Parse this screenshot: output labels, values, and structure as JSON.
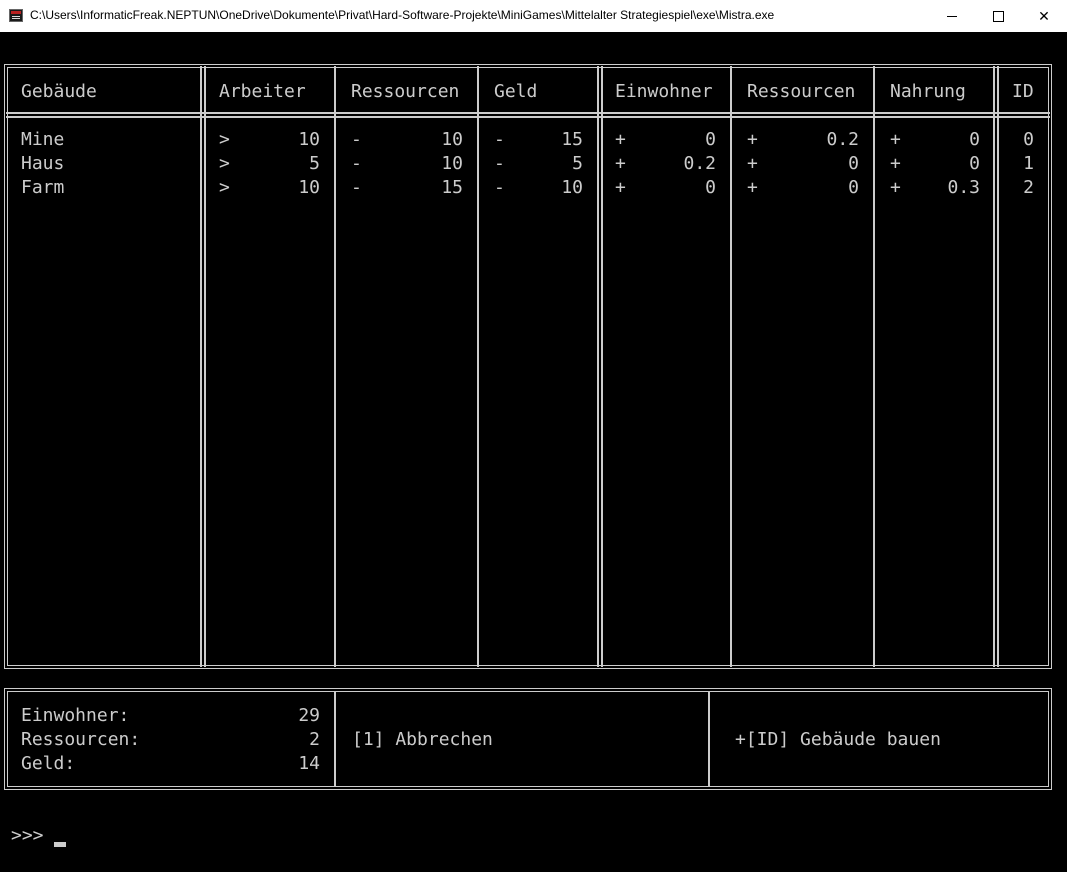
{
  "window": {
    "title": "C:\\Users\\InformaticFreak.NEPTUN\\OneDrive\\Dokumente\\Privat\\Hard-Software-Projekte\\MiniGames\\Mittelalter Strategiespiel\\exe\\Mistra.exe",
    "icon": "console-app-icon",
    "controls": {
      "minimize": "minimize-icon",
      "maximize": "maximize-icon",
      "close": "✕"
    }
  },
  "table": {
    "headers": [
      "Gebäude",
      "Arbeiter",
      "Ressourcen",
      "Geld",
      "Einwohner",
      "Ressourcen",
      "Nahrung",
      "ID"
    ],
    "rows": [
      {
        "name": "Mine",
        "arbeiter_sign": ">",
        "arbeiter": "10",
        "ressourcen_sign": "-",
        "ressourcen": "10",
        "geld_sign": "-",
        "geld": "15",
        "einwohner_sign": "+",
        "einwohner": "0",
        "res_prod_sign": "+",
        "res_prod": "0.2",
        "nahrung_sign": "+",
        "nahrung": "0",
        "id": "0"
      },
      {
        "name": "Haus",
        "arbeiter_sign": ">",
        "arbeiter": "5",
        "ressourcen_sign": "-",
        "ressourcen": "10",
        "geld_sign": "-",
        "geld": "5",
        "einwohner_sign": "+",
        "einwohner": "0.2",
        "res_prod_sign": "+",
        "res_prod": "0",
        "nahrung_sign": "+",
        "nahrung": "0",
        "id": "1"
      },
      {
        "name": "Farm",
        "arbeiter_sign": ">",
        "arbeiter": "10",
        "ressourcen_sign": "-",
        "ressourcen": "15",
        "geld_sign": "-",
        "geld": "10",
        "einwohner_sign": "+",
        "einwohner": "0",
        "res_prod_sign": "+",
        "res_prod": "0",
        "nahrung_sign": "+",
        "nahrung": "0.3",
        "id": "2"
      }
    ]
  },
  "status": {
    "einwohner_label": "Einwohner:",
    "einwohner_value": "29",
    "ressourcen_label": "Ressourcen:",
    "ressourcen_value": "2",
    "geld_label": "Geld:",
    "geld_value": "14"
  },
  "actions": {
    "cancel": "[1] Abbrechen",
    "build": "+[ID] Gebäude bauen"
  },
  "prompt": ">>>"
}
